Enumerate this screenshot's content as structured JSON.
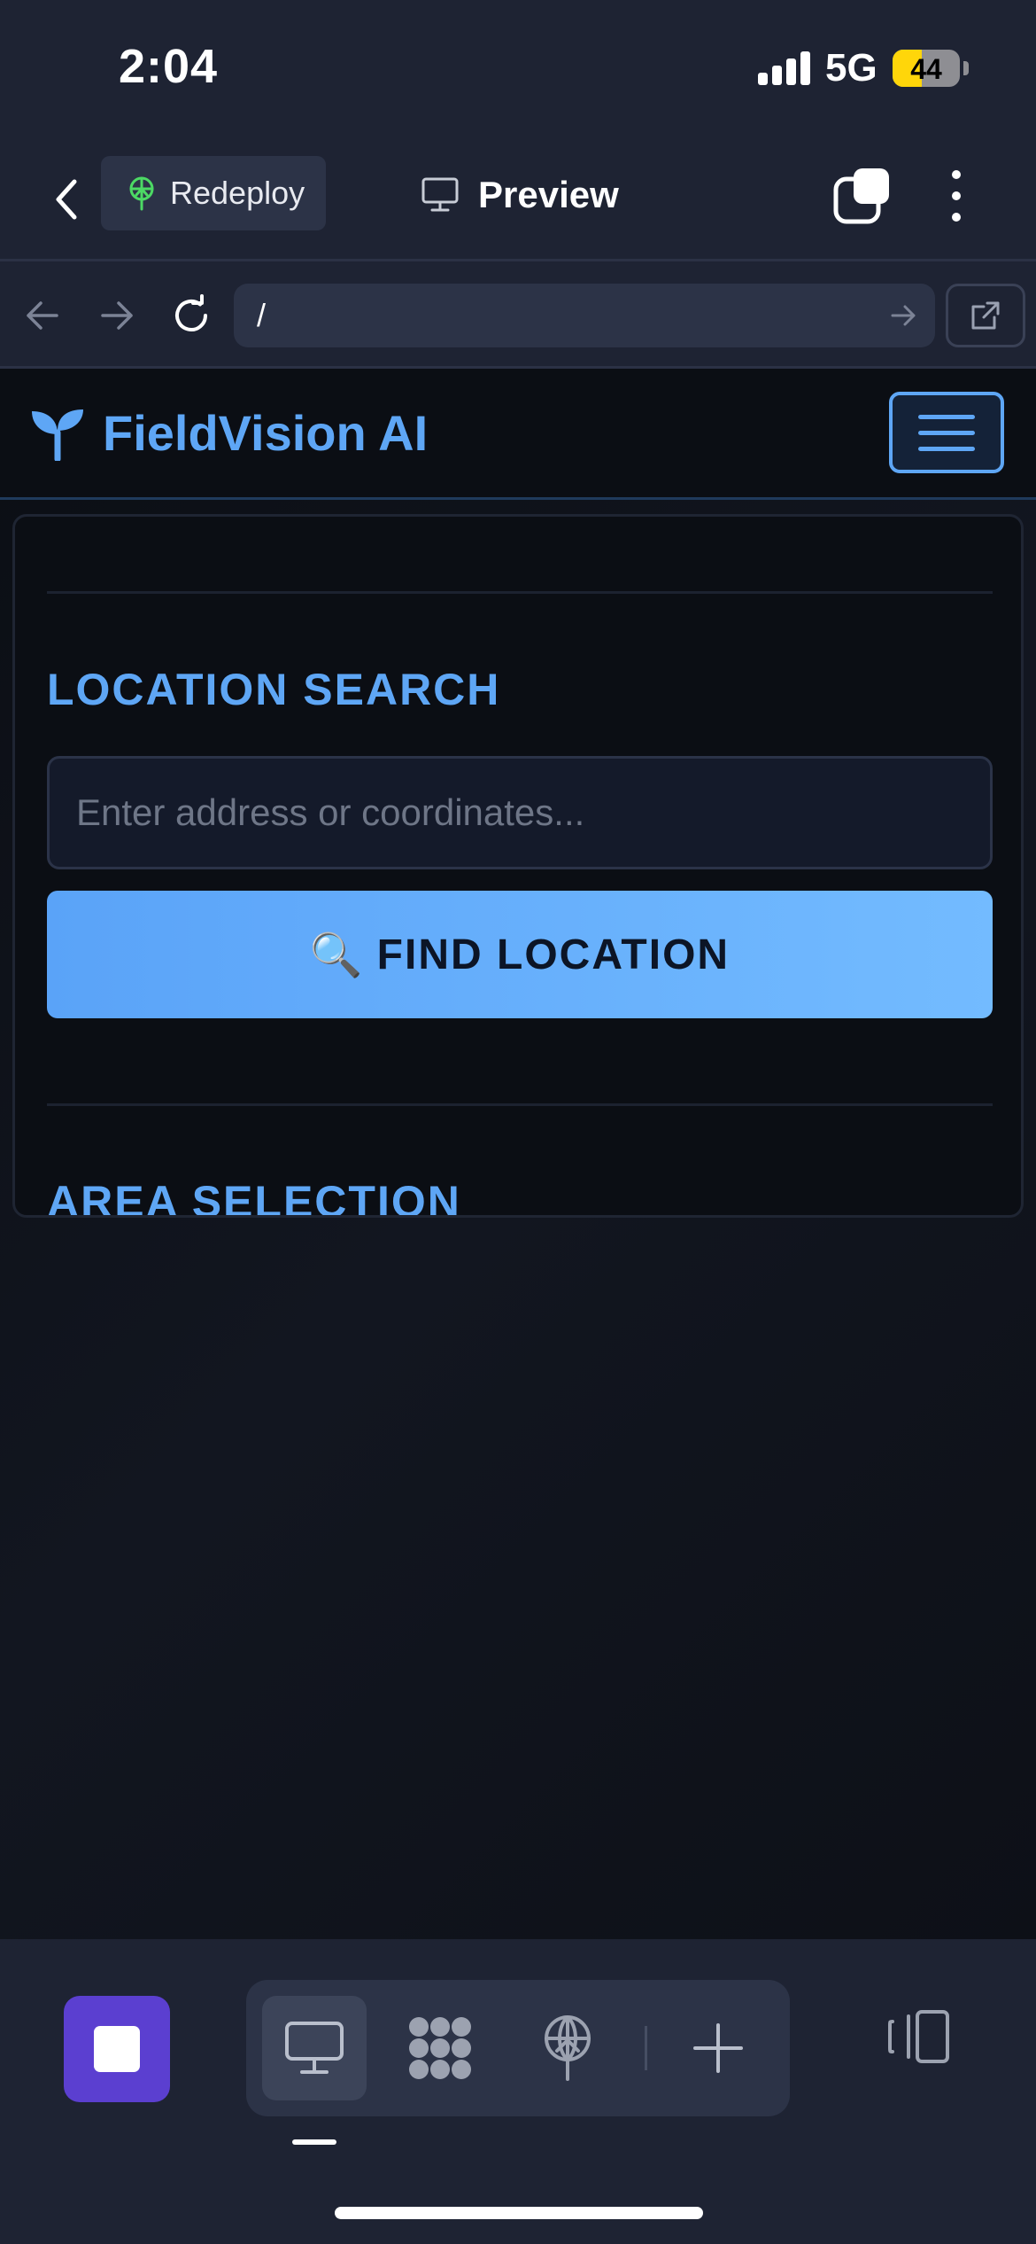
{
  "status_bar": {
    "time": "2:04",
    "network": "5G",
    "battery_level": "44",
    "battery_fraction": 0.44
  },
  "top_bar": {
    "redeploy_label": "Redeploy",
    "preview_label": "Preview"
  },
  "url_bar": {
    "path": "/"
  },
  "app": {
    "brand": "FieldVision AI",
    "location_search": {
      "title": "LOCATION SEARCH",
      "input_placeholder": "Enter address or coordinates...",
      "input_value": "",
      "button_icon": "🔍",
      "button_label": "FIND LOCATION"
    },
    "area_selection": {
      "title": "AREA SELECTION"
    }
  },
  "colors": {
    "accent": "#5ea6f5",
    "button_gradient_start": "#5aa3f8",
    "button_gradient_end": "#73bbff",
    "stop_button": "#5b3fd0",
    "redeploy_icon": "#4cd964",
    "battery_fill": "#ffd60a"
  },
  "icons": {
    "top_bar": [
      "chevron-left-icon",
      "redeploy-icon",
      "monitor-icon",
      "tabs-icon",
      "more-vertical-icon"
    ],
    "url_bar": [
      "arrow-left-icon",
      "arrow-right-icon",
      "reload-icon",
      "go-arrow-icon",
      "external-link-icon"
    ],
    "app_header": [
      "sprout-icon",
      "hamburger-menu-icon"
    ],
    "bottom_bar": [
      "stop-icon",
      "monitor-icon",
      "grid-blob-icon",
      "deploy-icon",
      "plus-icon",
      "panels-icon"
    ]
  }
}
